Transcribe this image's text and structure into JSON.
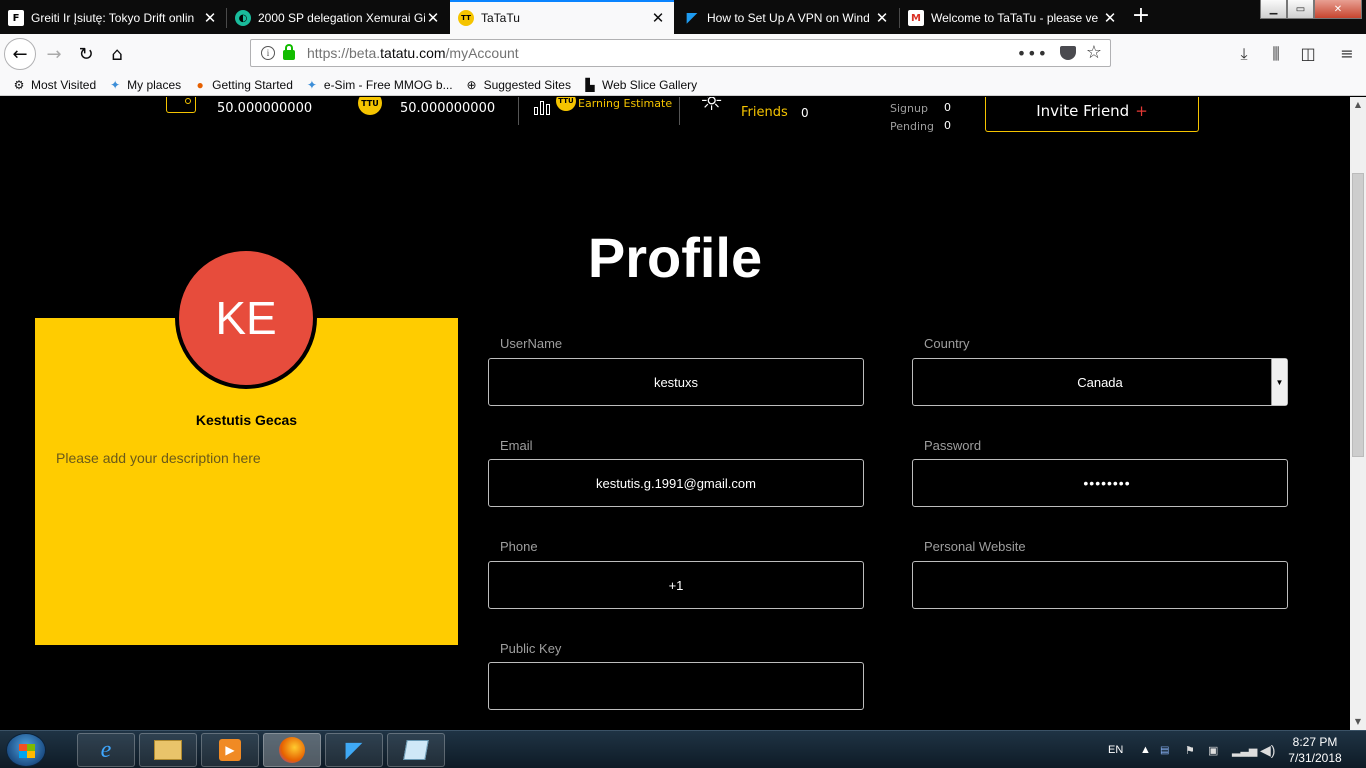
{
  "browser": {
    "tabs": [
      {
        "label": "Greiti Ir Įsiutę: Tokyo Drift onlin",
        "favicon": "F",
        "favicon_bg": "#ffffff",
        "favicon_color": "#000000"
      },
      {
        "label": "2000 SP delegation Xemurai Gi",
        "favicon": "S",
        "favicon_bg": "#1abc9c",
        "favicon_color": "#ffffff"
      },
      {
        "label": "TaTaTu",
        "favicon": "TT",
        "favicon_bg": "#f5c400",
        "favicon_color": "#000000"
      },
      {
        "label": "How to Set Up A VPN on Wind",
        "favicon": "▼",
        "favicon_bg": "#0c0c0c",
        "favicon_color": "#1e9bf0"
      },
      {
        "label": "Welcome to TaTaTu - please ve",
        "favicon": "M",
        "favicon_bg": "#ffffff",
        "favicon_color": "#d93025"
      }
    ],
    "url_prefix": "https://beta.",
    "url_domain": "tatatu.com",
    "url_path": "/myAccount",
    "bookmarks": [
      {
        "label": "Most Visited",
        "icon": "gear-icon"
      },
      {
        "label": "My places",
        "icon": "globe-icon"
      },
      {
        "label": "Getting Started",
        "icon": "firefox-icon"
      },
      {
        "label": "e-Sim - Free MMOG b...",
        "icon": "globe-icon"
      },
      {
        "label": "Suggested Sites",
        "icon": "globe-icon"
      },
      {
        "label": "Web Slice Gallery",
        "icon": "slice-icon"
      }
    ]
  },
  "stats": {
    "balance_1": "50.000000000",
    "balance_2": "50.000000000",
    "earning_estimate_label": "Earning Estimate",
    "friends_label": "Friends",
    "friends_count": "0",
    "signup_label": "Signup",
    "signup_count": "0",
    "pending_label": "Pending",
    "pending_count": "0",
    "invite_label": "Invite Friend",
    "invite_plus": "+"
  },
  "profile": {
    "title": "Profile",
    "initials": "KE",
    "name": "Kestutis Gecas",
    "description_placeholder": "Please add your description here",
    "fields": {
      "username_label": "UserName",
      "username_value": "kestuxs",
      "country_label": "Country",
      "country_value": "Canada",
      "email_label": "Email",
      "email_value": "kestutis.g.1991@gmail.com",
      "password_label": "Password",
      "password_value": "••••••••",
      "phone_label": "Phone",
      "phone_value": "+1",
      "website_label": "Personal Website",
      "website_value": "",
      "publickey_label": "Public Key",
      "publickey_value": ""
    }
  },
  "taskbar": {
    "language": "EN",
    "time": "8:27 PM",
    "date": "7/31/2018"
  },
  "colors": {
    "accent_yellow": "#ffcc00",
    "avatar_red": "#e74c3c",
    "firefox_tab_accent": "#0a84ff"
  }
}
